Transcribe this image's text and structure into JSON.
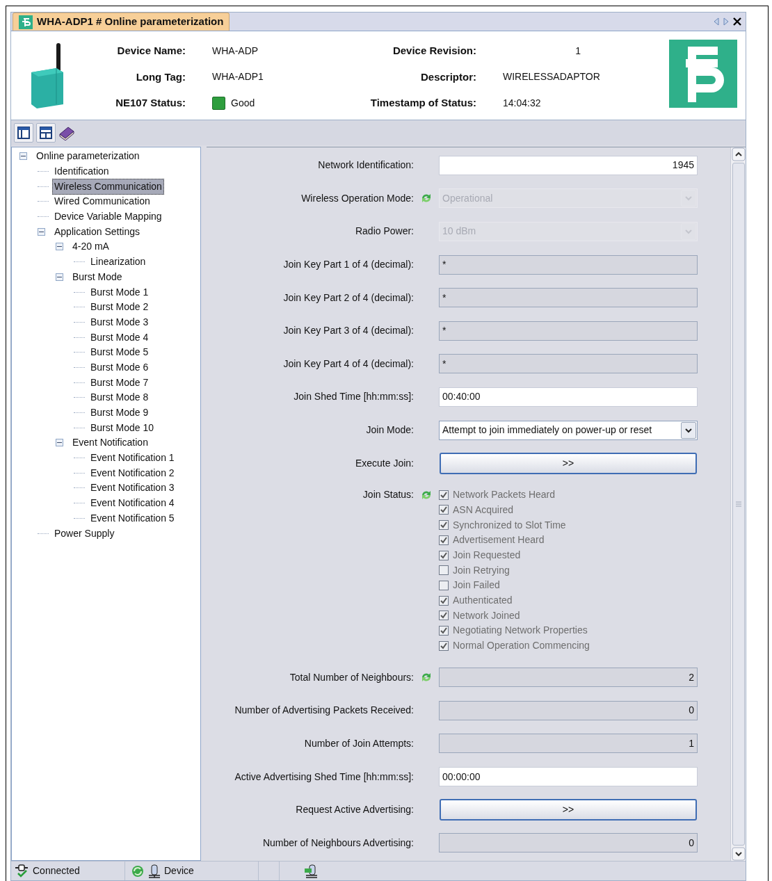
{
  "window": {
    "tab_title": "WHA-ADP1 # Online parameterization"
  },
  "header": {
    "fields": [
      {
        "label": "Device Name:",
        "value": "WHA-ADP",
        "kind": "text"
      },
      {
        "label": "Device Revision:",
        "value": "1",
        "kind": "number"
      },
      {
        "label": "Long Tag:",
        "value": "WHA-ADP1",
        "kind": "text"
      },
      {
        "label": "Descriptor:",
        "value": "WIRELESSADAPTOR",
        "kind": "text"
      },
      {
        "label": "NE107 Status:",
        "value": "Good",
        "kind": "status",
        "color": "#2e9e3e"
      },
      {
        "label": "Timestamp of Status:",
        "value": "14:04:32",
        "kind": "text"
      }
    ]
  },
  "tree": [
    {
      "label": "Online parameterization",
      "selected": false,
      "expanded": true,
      "children": [
        {
          "label": "Identification",
          "selected": false
        },
        {
          "label": "Wireless Communication",
          "selected": true
        },
        {
          "label": "Wired Communication",
          "selected": false
        },
        {
          "label": "Device Variable Mapping",
          "selected": false
        },
        {
          "label": "Application Settings",
          "selected": false,
          "expanded": true,
          "children": [
            {
              "label": "4-20 mA",
              "selected": false,
              "expanded": true,
              "children": [
                {
                  "label": "Linearization",
                  "selected": false
                }
              ]
            },
            {
              "label": "Burst Mode",
              "selected": false,
              "expanded": true,
              "children": [
                {
                  "label": "Burst Mode 1",
                  "selected": false
                },
                {
                  "label": "Burst Mode 2",
                  "selected": false
                },
                {
                  "label": "Burst Mode 3",
                  "selected": false
                },
                {
                  "label": "Burst Mode 4",
                  "selected": false
                },
                {
                  "label": "Burst Mode 5",
                  "selected": false
                },
                {
                  "label": "Burst Mode 6",
                  "selected": false
                },
                {
                  "label": "Burst Mode 7",
                  "selected": false
                },
                {
                  "label": "Burst Mode 8",
                  "selected": false
                },
                {
                  "label": "Burst Mode 9",
                  "selected": false
                },
                {
                  "label": "Burst Mode 10",
                  "selected": false
                }
              ]
            },
            {
              "label": "Event Notification",
              "selected": false,
              "expanded": true,
              "children": [
                {
                  "label": "Event Notification 1",
                  "selected": false
                },
                {
                  "label": "Event Notification 2",
                  "selected": false
                },
                {
                  "label": "Event Notification 3",
                  "selected": false
                },
                {
                  "label": "Event Notification 4",
                  "selected": false
                },
                {
                  "label": "Event Notification 5",
                  "selected": false
                }
              ]
            }
          ]
        },
        {
          "label": "Power Supply",
          "selected": false
        }
      ]
    }
  ],
  "form": [
    {
      "kind": "number",
      "label": "Network Identification:",
      "value": "1945",
      "editable": true,
      "refresh": false
    },
    {
      "kind": "select",
      "label": "Wireless Operation Mode:",
      "value": "Operational",
      "disabled": true,
      "refresh": true
    },
    {
      "kind": "select",
      "label": "Radio Power:",
      "value": "10 dBm",
      "disabled": true,
      "refresh": false
    },
    {
      "kind": "text",
      "label": "Join Key Part 1 of 4 (decimal):",
      "value": "*",
      "editable": false,
      "refresh": false
    },
    {
      "kind": "text",
      "label": "Join Key Part 2 of 4 (decimal):",
      "value": "*",
      "editable": false,
      "refresh": false
    },
    {
      "kind": "text",
      "label": "Join Key Part 3 of 4 (decimal):",
      "value": "*",
      "editable": false,
      "refresh": false
    },
    {
      "kind": "text",
      "label": "Join Key Part 4 of 4 (decimal):",
      "value": "*",
      "editable": false,
      "refresh": false
    },
    {
      "kind": "text",
      "label": "Join Shed Time [hh:mm:ss]:",
      "value": "00:40:00",
      "editable": true,
      "refresh": false
    },
    {
      "kind": "select",
      "label": "Join Mode:",
      "value": "Attempt to join immediately on power-up or reset",
      "disabled": false,
      "refresh": false
    },
    {
      "kind": "button",
      "label": "Execute Join:",
      "value": ">>",
      "refresh": false
    },
    {
      "kind": "checklist",
      "label": "Join Status:",
      "refresh": true,
      "disabled": true,
      "items": [
        {
          "label": "Network Packets Heard",
          "checked": true
        },
        {
          "label": "ASN Acquired",
          "checked": true
        },
        {
          "label": "Synchronized to Slot Time",
          "checked": true
        },
        {
          "label": "Advertisement Heard",
          "checked": true
        },
        {
          "label": "Join Requested",
          "checked": true
        },
        {
          "label": "Join Retrying",
          "checked": false
        },
        {
          "label": "Join Failed",
          "checked": false
        },
        {
          "label": "Authenticated",
          "checked": true
        },
        {
          "label": "Network Joined",
          "checked": true
        },
        {
          "label": "Negotiating Network Properties",
          "checked": true
        },
        {
          "label": "Normal Operation Commencing",
          "checked": true
        }
      ]
    },
    {
      "kind": "number",
      "label": "Total Number of Neighbours:",
      "value": "2",
      "editable": false,
      "refresh": true
    },
    {
      "kind": "number",
      "label": "Number of Advertising Packets Received:",
      "value": "0",
      "editable": false,
      "refresh": false
    },
    {
      "kind": "number",
      "label": "Number of Join Attempts:",
      "value": "1",
      "editable": false,
      "refresh": false
    },
    {
      "kind": "text",
      "label": "Active Advertising Shed Time [hh:mm:ss]:",
      "value": "00:00:00",
      "editable": true,
      "refresh": false
    },
    {
      "kind": "button",
      "label": "Request Active Advertising:",
      "value": ">>",
      "refresh": false
    },
    {
      "kind": "number",
      "label": "Number of Neighbours Advertising:",
      "value": "0",
      "editable": false,
      "refresh": false
    }
  ],
  "status_bar": {
    "connection": "Connected",
    "device": "Device"
  }
}
